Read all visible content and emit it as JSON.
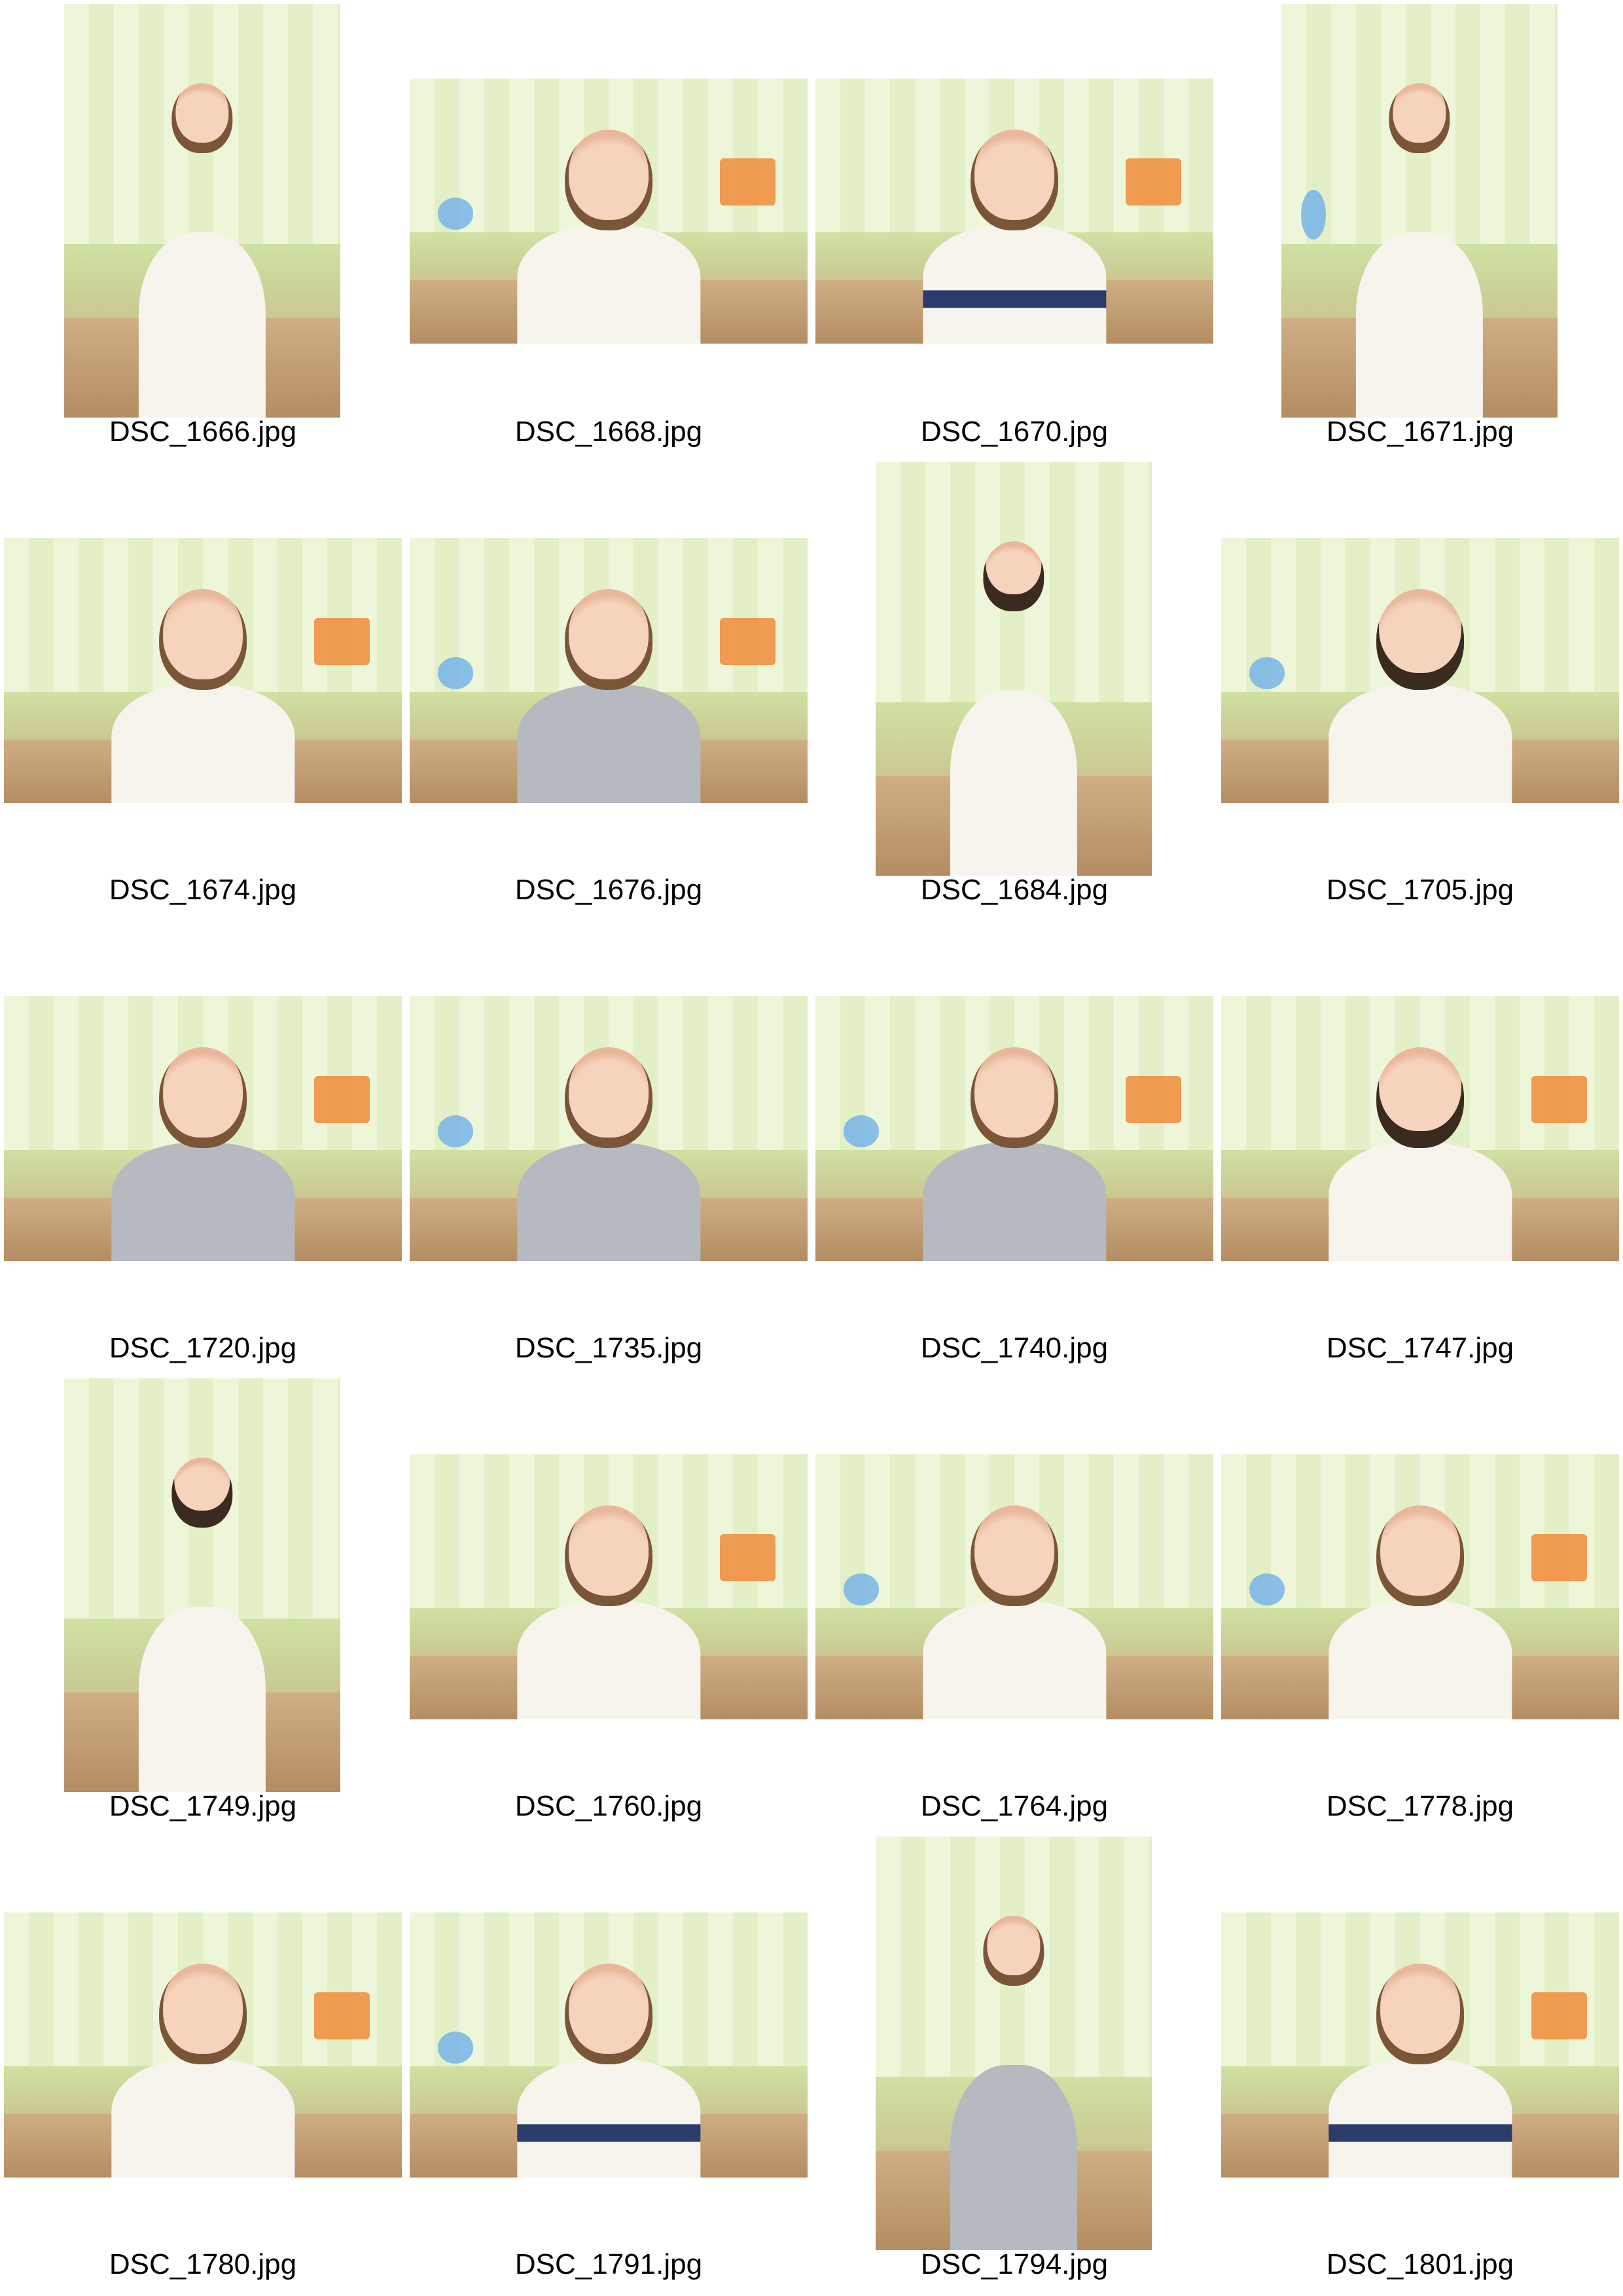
{
  "contact_sheet": {
    "items": [
      {
        "filename": "DSC_1666.jpg"
      },
      {
        "filename": "DSC_1668.jpg"
      },
      {
        "filename": "DSC_1670.jpg"
      },
      {
        "filename": "DSC_1671.jpg"
      },
      {
        "filename": "DSC_1674.jpg"
      },
      {
        "filename": "DSC_1676.jpg"
      },
      {
        "filename": "DSC_1684.jpg"
      },
      {
        "filename": "DSC_1705.jpg"
      },
      {
        "filename": "DSC_1720.jpg"
      },
      {
        "filename": "DSC_1735.jpg"
      },
      {
        "filename": "DSC_1740.jpg"
      },
      {
        "filename": "DSC_1747.jpg"
      },
      {
        "filename": "DSC_1749.jpg"
      },
      {
        "filename": "DSC_1760.jpg"
      },
      {
        "filename": "DSC_1764.jpg"
      },
      {
        "filename": "DSC_1778.jpg"
      },
      {
        "filename": "DSC_1780.jpg"
      },
      {
        "filename": "DSC_1791.jpg"
      },
      {
        "filename": "DSC_1794.jpg"
      },
      {
        "filename": "DSC_1801.jpg"
      }
    ]
  }
}
